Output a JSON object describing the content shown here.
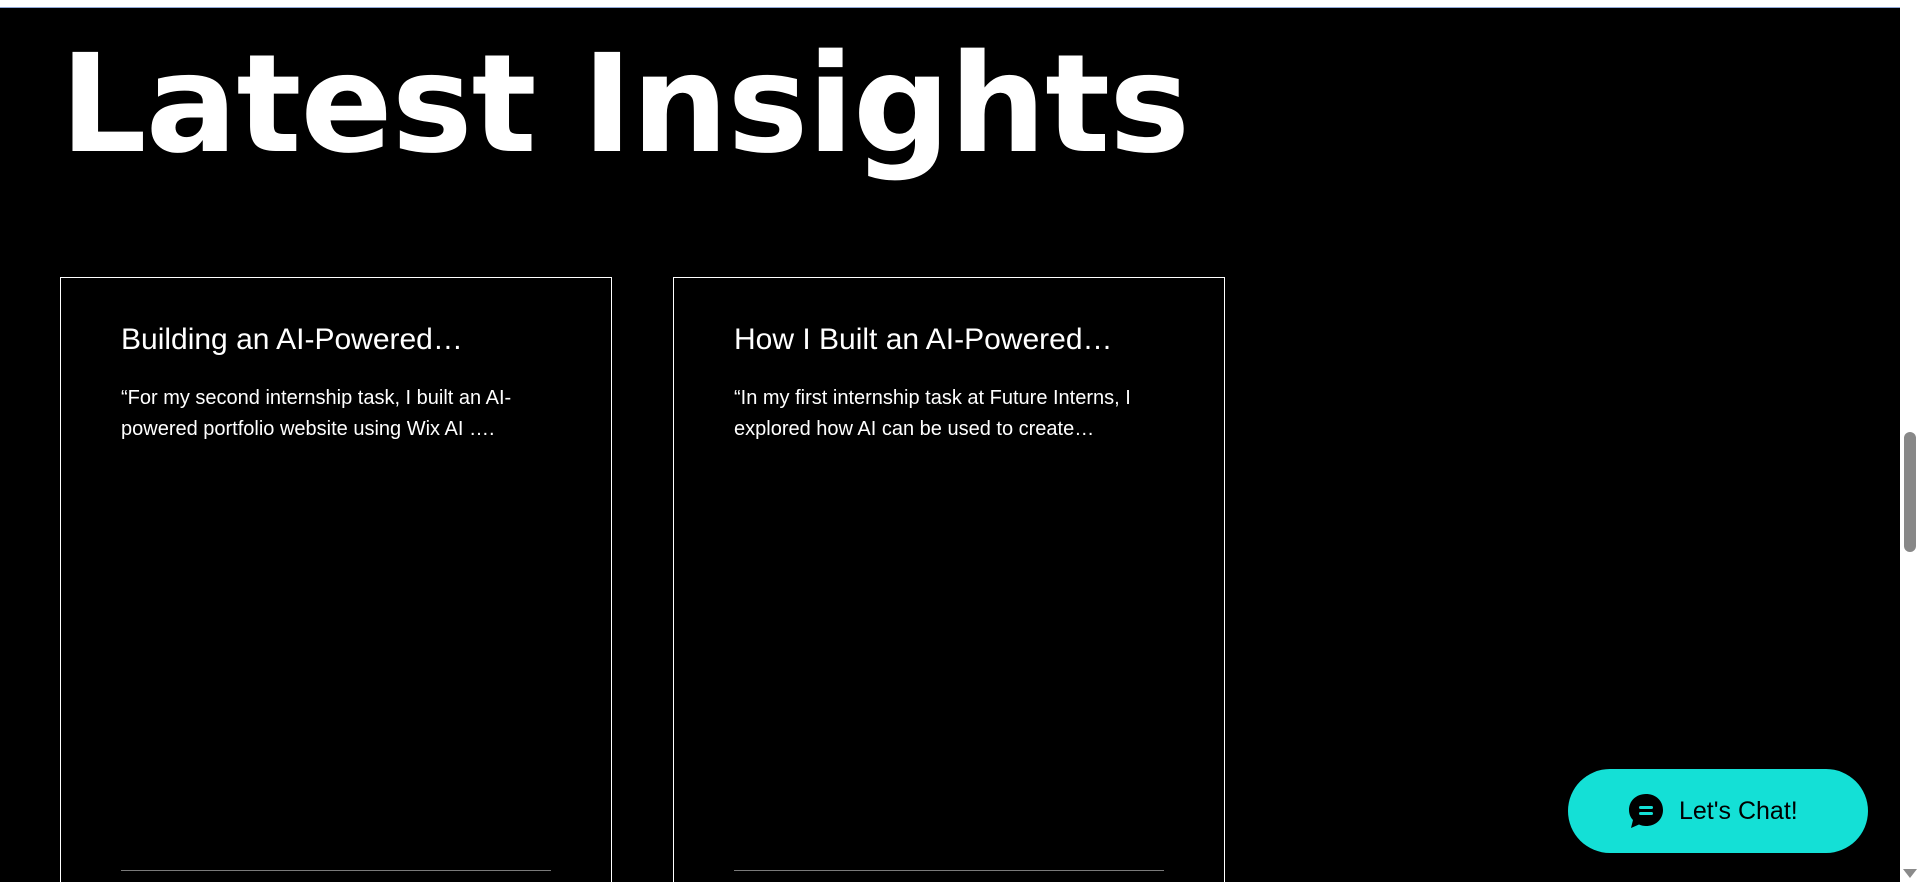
{
  "page": {
    "title": "Latest Insights"
  },
  "cards": [
    {
      "title": "Building an AI-Powered…",
      "excerpt": "“For my second internship task, I built an AI-powered portfolio website  using Wix AI …."
    },
    {
      "title": "How I Built an AI-Powered…",
      "excerpt": "“In my first internship task at Future Interns, I explored how AI can be used to create…"
    }
  ],
  "chat": {
    "label": "Let's Chat!",
    "icon": "chat-bubble-icon",
    "color": "#14e0d6"
  },
  "colors": {
    "background": "#000000",
    "text": "#ffffff",
    "accent": "#14e0d6"
  }
}
